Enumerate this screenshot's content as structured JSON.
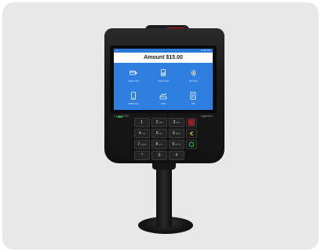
{
  "screen": {
    "status_left": "◂",
    "status_right": "10:42 AM",
    "amount_title": "Amount $15.00",
    "tiles": [
      {
        "icon": "card-swipe-icon",
        "label": "Swipe Card"
      },
      {
        "icon": "card-insert-icon",
        "label": "Insert Card"
      },
      {
        "icon": "contactless-icon",
        "label": "Tap Card"
      },
      {
        "icon": "mobile-pay-icon",
        "label": "Mobile Pay"
      },
      {
        "icon": "cash-icon",
        "label": "Cash"
      },
      {
        "icon": "receipt-icon",
        "label": "Gift"
      }
    ]
  },
  "device": {
    "model": "Lane/8000",
    "brand": "ingenico"
  },
  "keypad": {
    "keys": [
      {
        "main": "1",
        "sub": ""
      },
      {
        "main": "2",
        "sub": "ABC"
      },
      {
        "main": "3",
        "sub": "DEF"
      },
      {
        "main": "4",
        "sub": "GHI"
      },
      {
        "main": "5",
        "sub": "JKL"
      },
      {
        "main": "6",
        "sub": "MNO"
      },
      {
        "main": "7",
        "sub": "PQRS"
      },
      {
        "main": "8",
        "sub": "TUV"
      },
      {
        "main": "9",
        "sub": "WXYZ"
      },
      {
        "main": "*",
        "sub": ""
      },
      {
        "main": "0",
        "sub": ""
      },
      {
        "main": "#",
        "sub": ""
      }
    ],
    "cancel_color": "#d9262f",
    "correct_color": "#e6c21a",
    "enter_color": "#27a845"
  },
  "colors": {
    "screen_blue": "#2f7fe0",
    "frame_bg": "#e8e8e8",
    "accent_red": "#c0121e"
  }
}
